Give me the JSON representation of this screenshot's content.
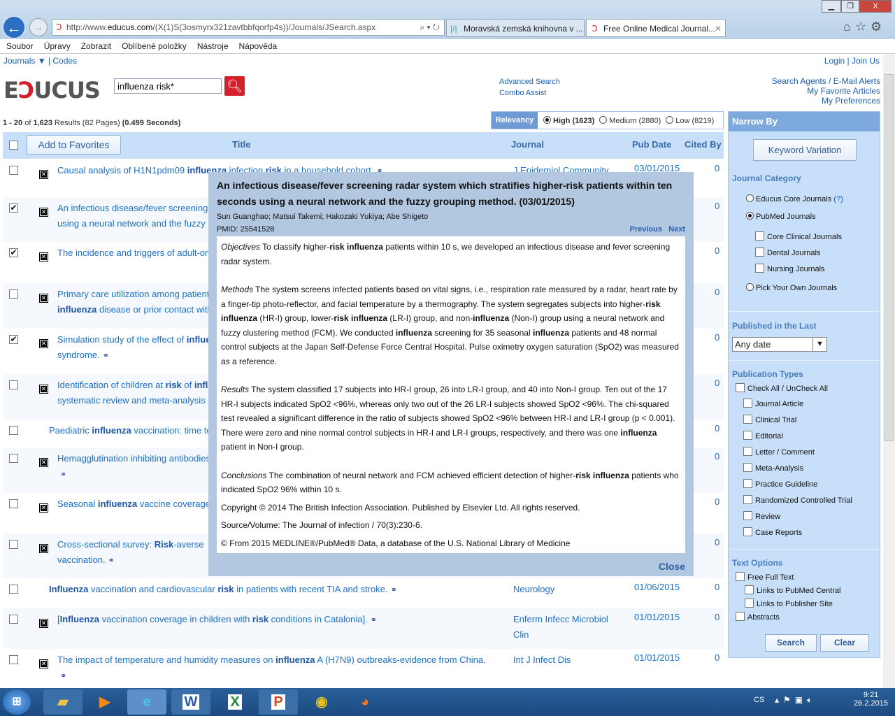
{
  "browser": {
    "url_prefix": "http://www.",
    "url_domain": "educus.com",
    "url_rest": "/(X(1)S(3osmyrx321zavtbbfqorfp4s))/Journals/JSearch.aspx",
    "tabs": [
      {
        "label": "Moravská zemská knihovna v ..."
      },
      {
        "label": "Free Online Medical Journal..."
      }
    ],
    "menu": [
      "Soubor",
      "Úpravy",
      "Zobrazit",
      "Oblíbené položky",
      "Nástroje",
      "Nápověda"
    ]
  },
  "top": {
    "journals": "Journals ▼",
    "codes": "Codes",
    "login": "Login",
    "join": "Join Us"
  },
  "logo": {
    "text": "EDUCUS"
  },
  "search": {
    "value": "influenza risk*"
  },
  "links": {
    "advanced": "Advanced Search",
    "combo": "Combo Assist",
    "agents": "Search Agents / E-Mail Alerts",
    "favorites": "My Favorite Articles",
    "preferences": "My Preferences"
  },
  "results": {
    "range": "1 - 20",
    "of": "of",
    "total": "1,623",
    "results": "Results",
    "pages": "(82 Pages)",
    "time": "(0.499",
    "seconds": "Seconds)"
  },
  "relevancy": {
    "label": "Relevancy",
    "options": [
      {
        "label": "High (1623)",
        "selected": true
      },
      {
        "label": "Medium (2880)",
        "selected": false
      },
      {
        "label": "Low (8219)",
        "selected": false
      }
    ]
  },
  "table": {
    "add_favorites": "Add to Favorites",
    "headers": {
      "title": "Title",
      "journal": "Journal",
      "pubdate": "Pub Date",
      "cited": "Cited By"
    },
    "rows": [
      {
        "checked": false,
        "icon": true,
        "title": [
          [
            "Causal analysis of H1N1pdm09 ",
            0
          ],
          [
            "influenza",
            1
          ],
          [
            " infection ",
            0
          ],
          [
            "risk",
            1
          ],
          [
            " in a household cohort.",
            0
          ]
        ],
        "link": true,
        "journal": "J Epidemiol Community",
        "date": "03/01/2015",
        "cited": "0"
      },
      {
        "checked": true,
        "icon": true,
        "title": [
          [
            "An infectious disease/fever screening radar system which stratifies higher-",
            0
          ],
          [
            "risk",
            1
          ],
          [
            " patients within ten seconds",
            0
          ]
        ],
        "title2": [
          [
            "using a neural network and the fuzzy grouping method.",
            0
          ]
        ],
        "journal": "",
        "date": "",
        "cited": "0"
      },
      {
        "checked": true,
        "icon": true,
        "title": [
          [
            "The incidence and triggers of adult-onset",
            0
          ]
        ],
        "journal": "",
        "date": "",
        "cited": "0"
      },
      {
        "checked": false,
        "icon": true,
        "title": [
          [
            "Primary care utilization among patients",
            0
          ]
        ],
        "title2": [
          [
            "influenza",
            1
          ],
          [
            " disease or prior contact with",
            0
          ]
        ],
        "journal": "",
        "date": "",
        "cited": "0"
      },
      {
        "checked": true,
        "icon": true,
        "title": [
          [
            "Simulation study of the effect of ",
            0
          ],
          [
            "influenza",
            1
          ]
        ],
        "title2": [
          [
            "syndrome.",
            0
          ]
        ],
        "link2": true,
        "journal": "",
        "date": "",
        "cited": "0"
      },
      {
        "checked": false,
        "icon": true,
        "title": [
          [
            "Identification of children at ",
            0
          ],
          [
            "risk",
            1
          ],
          [
            " of ",
            0
          ],
          [
            "influenza",
            1
          ]
        ],
        "title2": [
          [
            "systematic review and meta-analysis",
            0
          ]
        ],
        "journal": "",
        "date": "",
        "cited": "0"
      },
      {
        "checked": false,
        "icon": false,
        "title": [
          [
            "Paediatric ",
            0
          ],
          [
            "influenza",
            1
          ],
          [
            " vaccination: time to",
            0
          ]
        ],
        "journal": "",
        "date": "",
        "cited": "0"
      },
      {
        "checked": false,
        "icon": true,
        "title": [
          [
            "Hemagglutination inhibiting antibodies",
            0
          ]
        ],
        "title2": [],
        "link2": true,
        "journal": "",
        "date": "",
        "cited": "0"
      },
      {
        "checked": false,
        "icon": true,
        "title": [
          [
            "Seasonal ",
            0
          ],
          [
            "influenza",
            1
          ],
          [
            " vaccine coverage",
            0
          ]
        ],
        "journal": "",
        "date": "",
        "cited": "0"
      },
      {
        "checked": false,
        "icon": true,
        "title": [
          [
            "Cross-sectional survey: ",
            0
          ],
          [
            "Risk",
            1
          ],
          [
            "-averse",
            0
          ]
        ],
        "title2": [
          [
            "vaccination.",
            0
          ]
        ],
        "link2": true,
        "journal": "",
        "date": "",
        "cited": "0"
      },
      {
        "checked": false,
        "icon": false,
        "title": [
          [
            "Influenza",
            1
          ],
          [
            " vaccination and cardiovascular ",
            0
          ],
          [
            "risk",
            1
          ],
          [
            " in patients with recent TIA and stroke.",
            0
          ]
        ],
        "link": true,
        "journal": "Neurology",
        "date": "01/06/2015",
        "cited": "0"
      },
      {
        "checked": false,
        "icon": true,
        "title": [
          [
            "[",
            0
          ],
          [
            "Influenza",
            1
          ],
          [
            " vaccination coverage in children with ",
            0
          ],
          [
            "risk",
            1
          ],
          [
            " conditions in Catalonia].",
            0
          ]
        ],
        "link": true,
        "journal": "Enferm Infecc Microbiol Clin",
        "date": "01/01/2015",
        "cited": "0"
      },
      {
        "checked": false,
        "icon": true,
        "title": [
          [
            "The impact of temperature and humidity measures on ",
            0
          ],
          [
            "influenza",
            1
          ],
          [
            " A (H7N9) outbreaks-evidence from China.",
            0
          ]
        ],
        "title2": [],
        "link2": true,
        "journal": "Int J Infect Dis",
        "date": "01/01/2015",
        "cited": "0"
      }
    ]
  },
  "modal": {
    "title": "An infectious disease/fever screening radar system which stratifies higher-risk patients within ten seconds using a neural network and the fuzzy grouping method. (03/01/2015)",
    "authors": "Sun Guanghao; Matsui Takemi; Hakozaki Yukiya; Abe Shigeto",
    "pmid": "PMID: 25541528",
    "previous": "Previous",
    "next": "Next",
    "close": "Close",
    "paragraphs": [
      [
        [
          "Objectives",
          2
        ],
        [
          "  To classify higher-",
          0
        ],
        [
          "risk influenza",
          1
        ],
        [
          " patients within 10 s, we developed an infectious disease and fever screening radar system.",
          0
        ]
      ],
      [
        [
          "Methods",
          2
        ],
        [
          "  The system screens infected patients based on vital signs, i.e., respiration rate measured by a radar, heart rate by a finger-tip photo-reflector, and facial temperature by a thermography. The system segregates subjects into higher-",
          0
        ],
        [
          "risk influenza",
          1
        ],
        [
          " (HR-I) group, lower-",
          0
        ],
        [
          "risk influenza",
          1
        ],
        [
          " (LR-I) group, and non-",
          0
        ],
        [
          "influenza",
          1
        ],
        [
          " (Non-I) group using a neural network and fuzzy clustering method (FCM). We conducted ",
          0
        ],
        [
          "influenza",
          1
        ],
        [
          " screening for 35 seasonal ",
          0
        ],
        [
          "influenza",
          1
        ],
        [
          " patients and 48 normal control subjects at the Japan Self-Defense Force Central Hospital. Pulse oximetry oxygen saturation (SpO2) was measured as a reference.",
          0
        ]
      ],
      [
        [
          "Results",
          2
        ],
        [
          "  The system classified 17 subjects into HR-I group, 26 into LR-I group, and 40 into Non-I group. Ten out of the 17 HR-I subjects indicated SpO2 <96%, whereas only two out of the 26 LR-I subjects showed SpO2 <96%. The chi-squared test revealed a significant difference in the ratio of subjects showed SpO2 <96% between HR-I and LR-I group (p < 0.001). There were zero and nine normal control subjects in HR-I and LR-I groups, respectively, and there was one ",
          0
        ],
        [
          "influenza",
          1
        ],
        [
          " patient in Non-I group.",
          0
        ]
      ],
      [
        [
          "Conclusions",
          2
        ],
        [
          "  The combination of neural network and FCM achieved efficient detection of higher-",
          0
        ],
        [
          "risk influenza",
          1
        ],
        [
          " patients who indicated SpO2 96% within 10 s.",
          0
        ]
      ]
    ],
    "copyright": "Copyright © 2014 The British Infection Association. Published by Elsevier Ltd. All rights reserved.",
    "source": "Source/Volume: The Journal of infection / 70(3):230-6.",
    "medline": "© From 2015 MEDLINE®/PubMed® Data, a database of the U.S. National Library of Medicine"
  },
  "narrow": {
    "title": "Narrow By",
    "keyword": "Keyword Variation",
    "journal_category": "Journal Category",
    "cat_options": [
      {
        "label": "Educus Core Journals",
        "help": "(?)",
        "selected": false
      },
      {
        "label": "PubMed Journals",
        "selected": true
      }
    ],
    "sub_journals": [
      "Core Clinical Journals",
      "Dental Journals",
      "Nursing Journals"
    ],
    "pick": "Pick Your Own Journals",
    "published": "Published in the Last",
    "date_value": "Any date",
    "pubtypes": "Publication Types",
    "check_all": "Check All / UnCheck All",
    "types": [
      "Journal Article",
      "Clinical Trial",
      "Editorial",
      "Letter / Comment",
      "Meta-Analysis",
      "Practice Guideline",
      "Randomized Controlled Trial",
      "Review",
      "Case Reports"
    ],
    "text_options": "Text Options",
    "free_full": "Free Full Text",
    "pmc": "Links to PubMed Central",
    "publisher": "Links to Publisher Site",
    "abstracts": "Abstracts",
    "search": "Search",
    "clear": "Clear"
  },
  "taskbar": {
    "lang": "CS",
    "time": "9:21",
    "date": "26.2.2015"
  }
}
